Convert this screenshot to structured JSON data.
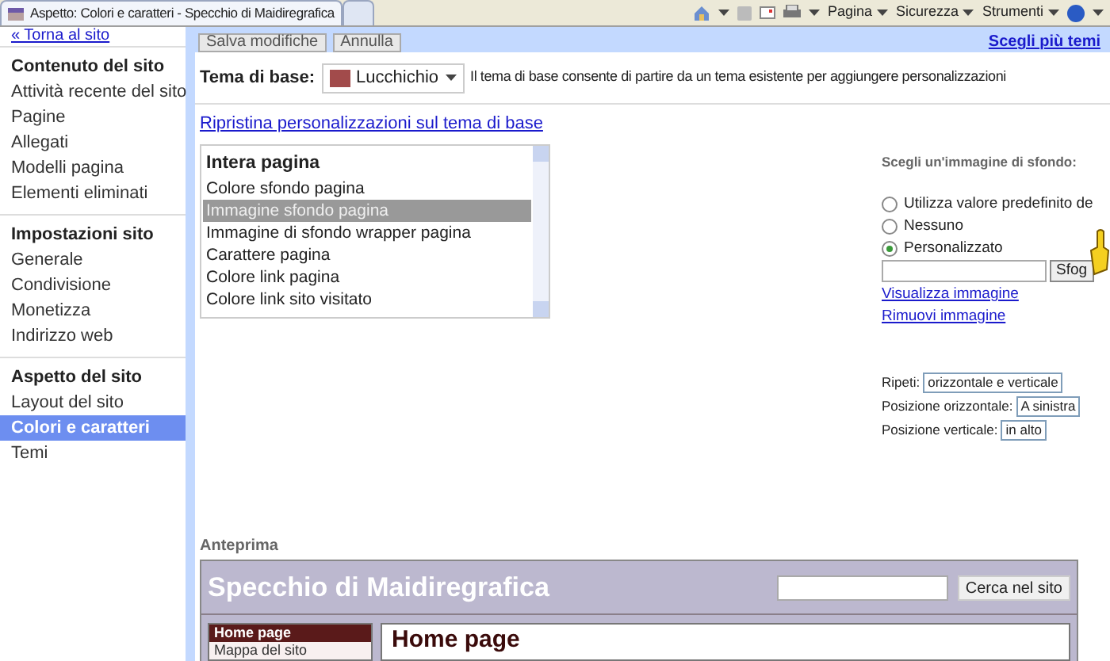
{
  "browser": {
    "tabs": [
      {
        "title": "Aspetto: Colori e caratteri - Specchio di Maidiregrafica",
        "selected": true
      },
      {
        "selected": false
      }
    ],
    "menus": [
      "Pagina",
      "Sicurezza",
      "Strumenti"
    ]
  },
  "sidebar": {
    "back_link": "« Torna al sito",
    "sections": [
      {
        "heading": "Contenuto del sito",
        "items": [
          {
            "label": "Attività recente del sito",
            "selected": false
          },
          {
            "label": "Pagine",
            "selected": false
          },
          {
            "label": "Allegati",
            "selected": false
          },
          {
            "label": "Modelli pagina",
            "selected": false
          },
          {
            "label": "Elementi eliminati",
            "selected": false
          }
        ]
      },
      {
        "heading": "Impostazioni sito",
        "items": [
          {
            "label": "Generale",
            "selected": false
          },
          {
            "label": "Condivisione",
            "selected": false
          },
          {
            "label": "Monetizza",
            "selected": false
          },
          {
            "label": "Indirizzo web",
            "selected": false
          }
        ]
      },
      {
        "heading": "Aspetto del sito",
        "items": [
          {
            "label": "Layout del sito",
            "selected": false
          },
          {
            "label": "Colori e caratteri",
            "selected": true
          },
          {
            "label": "Temi",
            "selected": false
          }
        ]
      }
    ]
  },
  "toolbar": {
    "buttons": [
      "Salva modifiche",
      "Annulla"
    ],
    "link": "Scegli più temi"
  },
  "theme": {
    "label": "Tema di base:",
    "value": "Lucchichio",
    "description": "Il tema di base consente di partire da un tema esistente per aggiungere personalizzazioni"
  },
  "reset_link": "Ripristina personalizzazioni sul tema di base",
  "element_list": {
    "heading": "Intera pagina",
    "items": [
      {
        "label": "Colore sfondo pagina",
        "selected": false
      },
      {
        "label": "Immagine sfondo pagina",
        "selected": true
      },
      {
        "label": "Immagine di sfondo wrapper pagina",
        "selected": false
      },
      {
        "label": "Carattere pagina",
        "selected": false
      },
      {
        "label": "Colore link pagina",
        "selected": false
      },
      {
        "label": "Colore link sito visitato",
        "selected": false
      }
    ]
  },
  "background": {
    "heading": "Scegli un'immagine di sfondo:",
    "options": [
      {
        "label": "Utilizza valore predefinito de",
        "selected": false
      },
      {
        "label": "Nessuno",
        "selected": false
      },
      {
        "label": "Personalizzato",
        "selected": true
      }
    ],
    "browse_button": "Sfog",
    "links": [
      "Visualizza immagine",
      "Rimuovi immagine"
    ],
    "settings": [
      {
        "label": "Ripeti:",
        "value": "orizzontale e verticale"
      },
      {
        "label": "Posizione orizzontale:",
        "value": "A sinistra"
      },
      {
        "label": "Posizione verticale:",
        "value": "in alto"
      }
    ]
  },
  "preview": {
    "heading": "Anteprima",
    "site_title": "Specchio di Maidiregrafica",
    "search_button": "Cerca nel sito",
    "nav": [
      {
        "label": "Home page",
        "selected": true
      },
      {
        "label": "Mappa del sito",
        "selected": false
      }
    ],
    "page_title": "Home page"
  }
}
